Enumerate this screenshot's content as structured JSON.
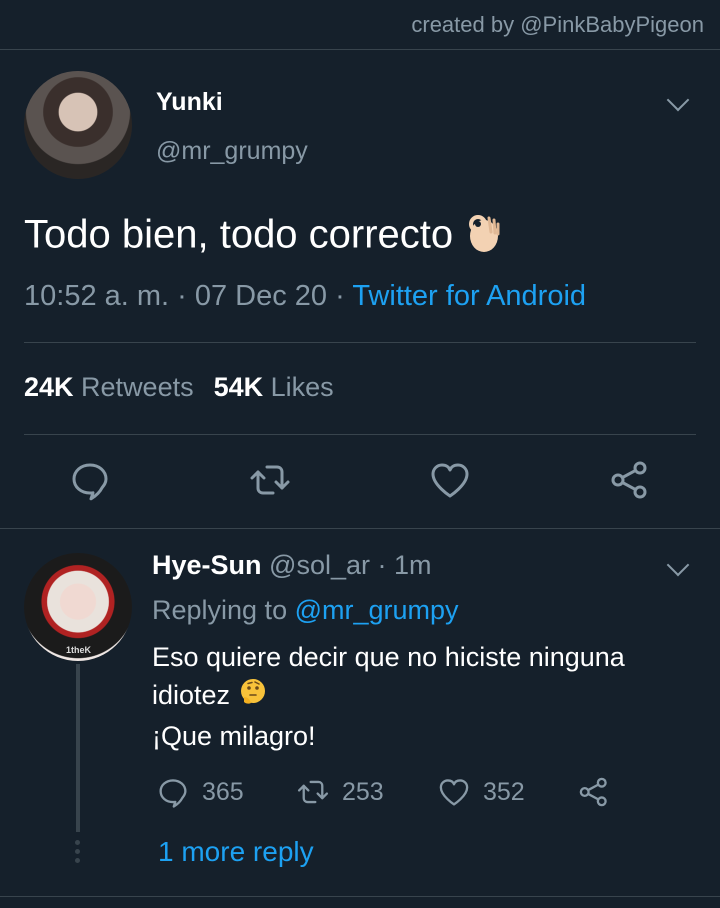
{
  "credit": "created by @PinkBabyPigeon",
  "tweet": {
    "name": "Yunki",
    "handle": "@mr_grumpy",
    "text": "Todo bien, todo correcto",
    "emoji": "ok-hand",
    "time": "10:52 a. m. · 07 Dec 20 · ",
    "source": "Twitter for Android",
    "retweets_count": "24K",
    "retweets_label": "Retweets",
    "likes_count": "54K",
    "likes_label": "Likes"
  },
  "reply": {
    "name": "Hye-Sun",
    "handle": "@sol_ar",
    "dot": "·",
    "age": "1m",
    "replying_label": "Replying to",
    "replying_handle": "@mr_grumpy",
    "line1": "Eso quiere decir que no hiciste ninguna",
    "line2": "idiotez",
    "line2_emoji": "thinking-face",
    "line3": "¡Que milagro!",
    "avatar_text": "1theK",
    "replies_count": "365",
    "retweets_count": "253",
    "likes_count": "352",
    "more_replies": "1 more reply"
  },
  "colors": {
    "background": "#15202b",
    "divider": "#38444d",
    "secondary_text": "#8899a6",
    "link": "#1da1f2"
  }
}
